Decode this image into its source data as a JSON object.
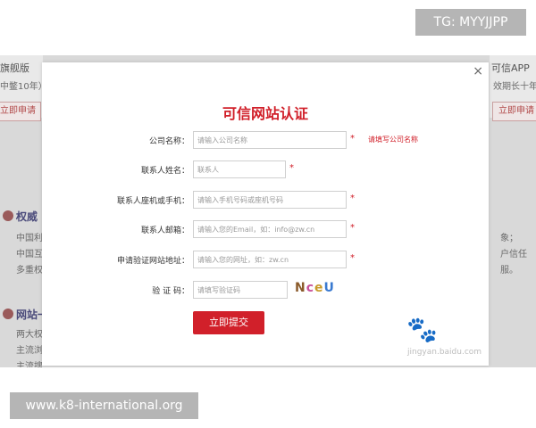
{
  "watermarks": {
    "tg": "TG: MYYJJPP",
    "site": "www.k8-international.org",
    "baidu_sub": "jingyan.baidu.com"
  },
  "background": {
    "left_title": "旗舰版",
    "left_sub": "中鳖10年）",
    "left_button": "立即申请",
    "right_title": "可信APP",
    "right_sub": "效期长十年",
    "right_button": "立即申请",
    "section1_heading": "权威",
    "section1_lines": [
      "中国利",
      "中国互",
      "多重权"
    ],
    "section1_right": [
      "象；",
      "户信任",
      "服。"
    ],
    "section2_heading": "网站一",
    "section2_lines": [
      "两大权",
      "主流浏",
      "主流搜"
    ]
  },
  "modal": {
    "close": "×",
    "title": "可信网站认证",
    "fields": [
      {
        "label": "公司名称：",
        "placeholder": "请输入公司名称",
        "required": "*",
        "hint": "请填写公司名称"
      },
      {
        "label": "联系人姓名：",
        "placeholder": "联系人",
        "required": "*"
      },
      {
        "label": "联系人座机或手机：",
        "placeholder": "请输入手机号码或座机号码",
        "required": "*"
      },
      {
        "label": "联系人邮箱：",
        "placeholder": "请输入您的Email，如：info@zw.cn",
        "required": "*"
      },
      {
        "label": "申请验证网站地址：",
        "placeholder": "请输入您的网址，如：zw.cn",
        "required": "*"
      },
      {
        "label": "验 证 码：",
        "placeholder": "请填写验证码"
      }
    ],
    "captcha_chars": [
      "N",
      "c",
      "e",
      "U"
    ],
    "submit": "立即提交"
  },
  "colors": {
    "accent": "#d1202a"
  }
}
